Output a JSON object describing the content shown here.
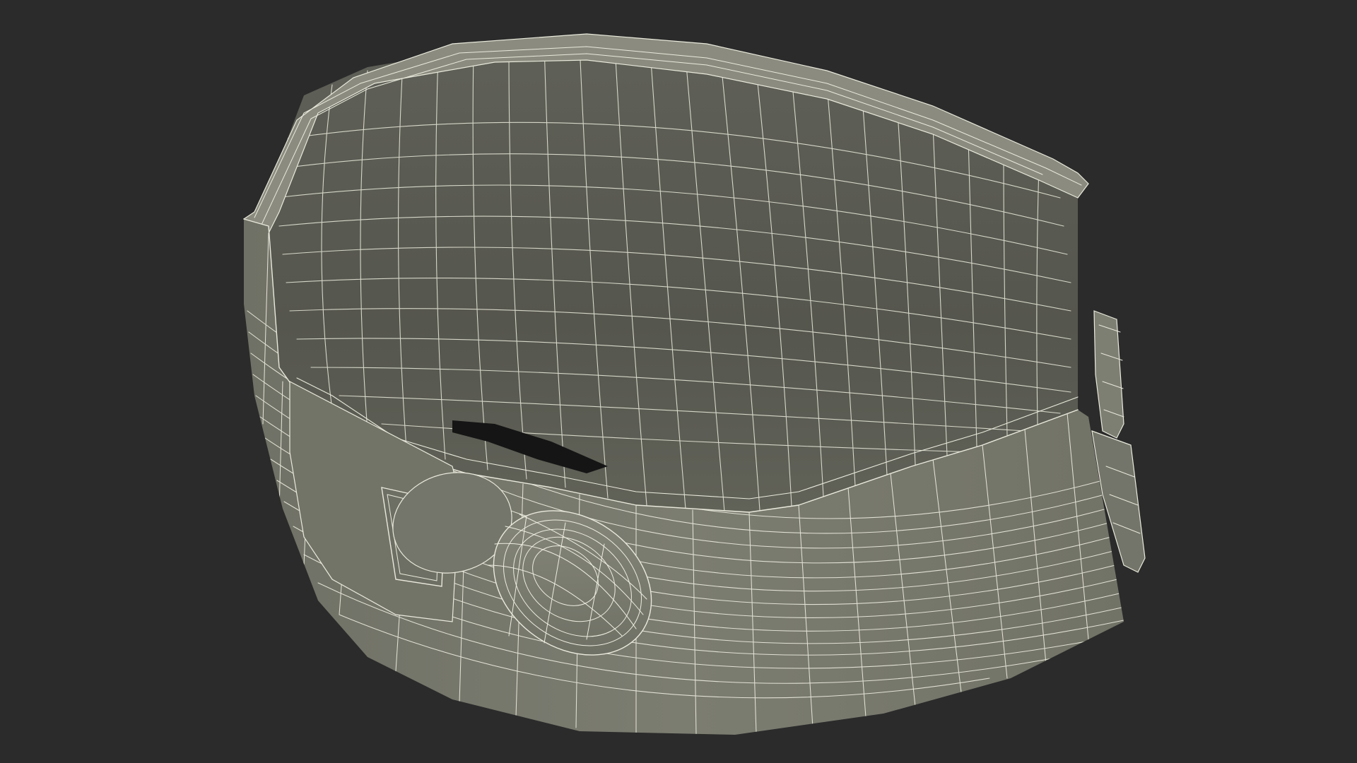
{
  "scene": {
    "background_color": "#2b2b2b",
    "object": "wireframe-collar-bracelet",
    "colors": {
      "outer_surface": "#7d7e72",
      "outer_surface_shadow": "#6a6b60",
      "inner_surface": "#5d5e55",
      "inner_surface_dark": "#4e4f47",
      "rim": "#8f9083",
      "wireframe": "#e9e9dc",
      "hole": "#151515"
    }
  }
}
